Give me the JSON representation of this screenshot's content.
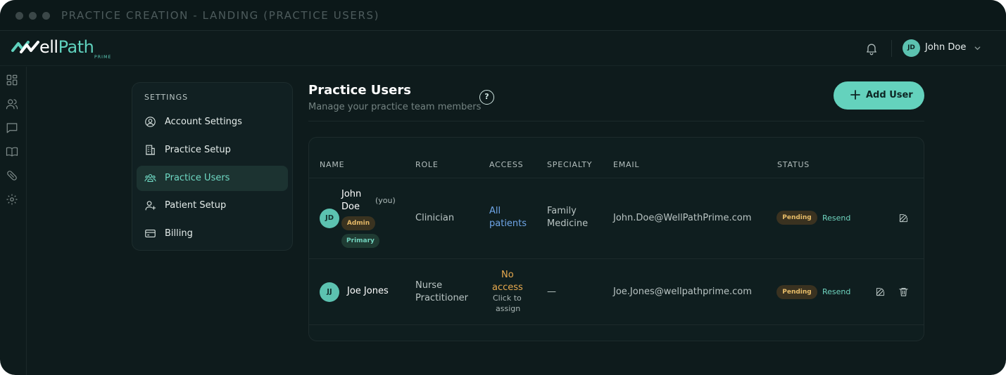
{
  "window": {
    "title": "PRACTICE CREATION - LANDING (PRACTICE USERS)"
  },
  "brand": {
    "logo_word_start": "ell",
    "logo_word_end": "Path",
    "logo_sub": "PRIME"
  },
  "header": {
    "user_initials": "JD",
    "user_name": "John Doe",
    "icons": [
      "bell-icon",
      "chevron-down-icon"
    ]
  },
  "rail": {
    "icons": [
      "dashboard-icon",
      "users-icon",
      "chat-icon",
      "book-icon",
      "pill-icon",
      "gear-icon"
    ]
  },
  "settings": {
    "heading": "SETTINGS",
    "items": [
      {
        "label": "Account Settings",
        "icon": "user-circle-icon",
        "active": false
      },
      {
        "label": "Practice Setup",
        "icon": "building-icon",
        "active": false
      },
      {
        "label": "Practice Users",
        "icon": "users-icon",
        "active": true
      },
      {
        "label": "Patient Setup",
        "icon": "user-plus-icon",
        "active": false
      },
      {
        "label": "Billing",
        "icon": "credit-card-icon",
        "active": false
      }
    ]
  },
  "page": {
    "title": "Practice Users",
    "subtitle": "Manage your practice team members",
    "help_glyph": "?",
    "add_user_label": "Add User"
  },
  "table": {
    "columns": [
      "NAME",
      "ROLE",
      "ACCESS",
      "SPECIALTY",
      "EMAIL",
      "STATUS"
    ],
    "rows": [
      {
        "initials": "JD",
        "name_line1": "John",
        "name_line2": "Doe",
        "you_tag": "(you)",
        "badges": [
          "Admin",
          "Primary"
        ],
        "role": "Clinician",
        "access_line1": "All",
        "access_line2": "patients",
        "specialty_line1": "Family",
        "specialty_line2": "Medicine",
        "email": "John.Doe@WellPathPrime.com",
        "status": "Pending",
        "resend": "Resend",
        "actions": [
          "edit-icon"
        ]
      },
      {
        "initials": "JJ",
        "name": "Joe Jones",
        "role_line1": "Nurse",
        "role_line2": "Practitioner",
        "access_line1": "No",
        "access_line2": "access",
        "access_hint_line1": "Click to",
        "access_hint_line2": "assign",
        "specialty": "—",
        "email": "Joe.Jones@wellpathprime.com",
        "status": "Pending",
        "resend": "Resend",
        "actions": [
          "edit-icon",
          "trash-icon"
        ]
      }
    ]
  },
  "colors": {
    "accent": "#64d2bd",
    "background": "#0e1b1c",
    "pending": "#e7bc68",
    "access_all": "#6fa6e8",
    "access_none": "#e7a94e"
  }
}
